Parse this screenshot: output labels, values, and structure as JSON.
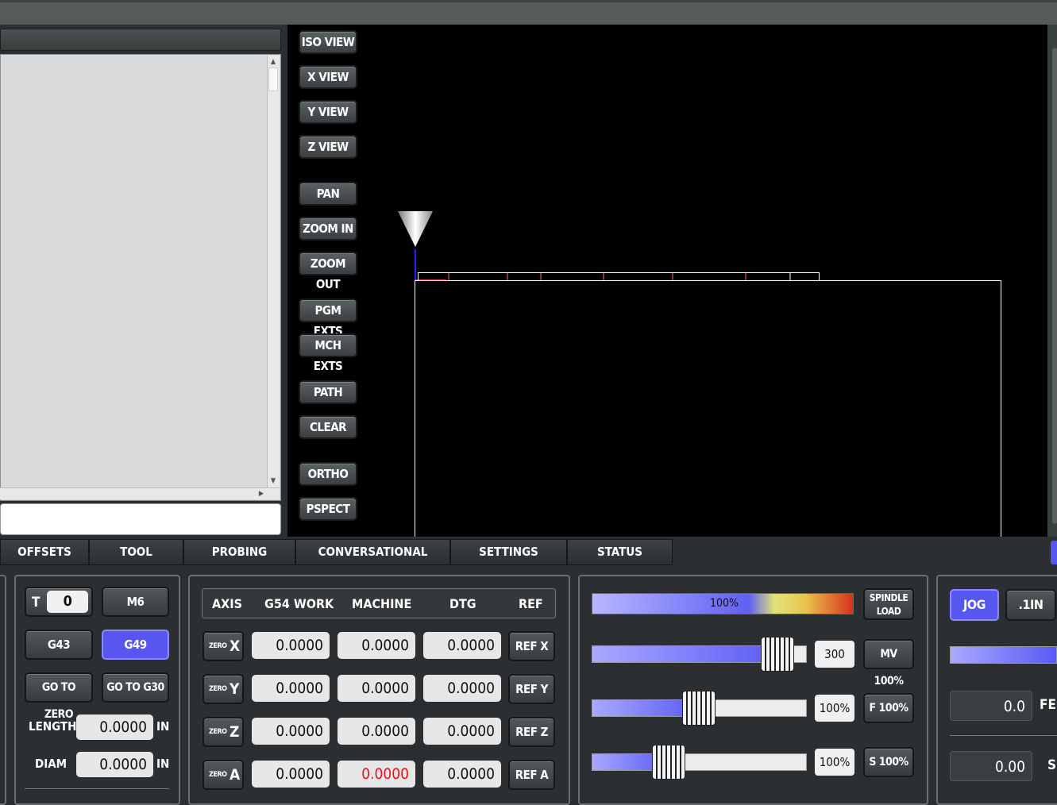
{
  "view_buttons": [
    "ISO VIEW",
    "X VIEW",
    "Y VIEW",
    "Z VIEW",
    "PAN",
    "ZOOM IN",
    "ZOOM OUT",
    "PGM EXTS",
    "MCH EXTS",
    "PATH",
    "CLEAR",
    "ORTHO",
    "PSPECT"
  ],
  "tabs": [
    "OFFSETS",
    "TOOL",
    "PROBING",
    "CONVERSATIONAL",
    "SETTINGS",
    "STATUS"
  ],
  "tool": {
    "t_label": "T",
    "t_value": "0",
    "m6": "M6",
    "g43": "G43",
    "g49": "G49",
    "go_to_zero": "GO TO ZERO",
    "go_to_g30": "GO TO G30",
    "length_label": "LENGTH",
    "length_value": "0.0000",
    "length_unit": "IN",
    "diam_label": "DIAM",
    "diam_value": "0.0000",
    "diam_unit": "IN"
  },
  "dro": {
    "headers": [
      "AXIS",
      "G54 WORK",
      "MACHINE",
      "DTG",
      "REF"
    ],
    "zero_prefix": "ZERO",
    "rows": [
      {
        "axis": "X",
        "work": "0.0000",
        "machine": "0.0000",
        "dtg": "0.0000",
        "ref": "REF X",
        "machine_color": "#111111"
      },
      {
        "axis": "Y",
        "work": "0.0000",
        "machine": "0.0000",
        "dtg": "0.0000",
        "ref": "REF Y",
        "machine_color": "#111111"
      },
      {
        "axis": "Z",
        "work": "0.0000",
        "machine": "0.0000",
        "dtg": "0.0000",
        "ref": "REF Z",
        "machine_color": "#111111"
      },
      {
        "axis": "A",
        "work": "0.0000",
        "machine": "0.0000",
        "dtg": "0.0000",
        "ref": "REF A",
        "machine_color": "#e8121b"
      }
    ]
  },
  "overrides": {
    "spindle_load_pct": "100%",
    "spindle_load_label": "SPINDLE LOAD",
    "max_velocity": {
      "value": "300",
      "button": "MV 100%",
      "fill_fraction": 0.87
    },
    "feed": {
      "value": "100%",
      "button": "F 100%",
      "fill_fraction": 0.5
    },
    "spindle": {
      "value": "100%",
      "button": "S 100%",
      "fill_fraction": 0.36
    }
  },
  "jog": {
    "jog_button": "JOG",
    "increment_button": ".1IN",
    "feed_value": "0.0",
    "feed_label": "FEE",
    "speed_value": "0.00",
    "speed_label": "S"
  },
  "colors": {
    "accent": "#5757f0",
    "active_border": "#8b8bff",
    "alarm_red": "#e8121b"
  }
}
